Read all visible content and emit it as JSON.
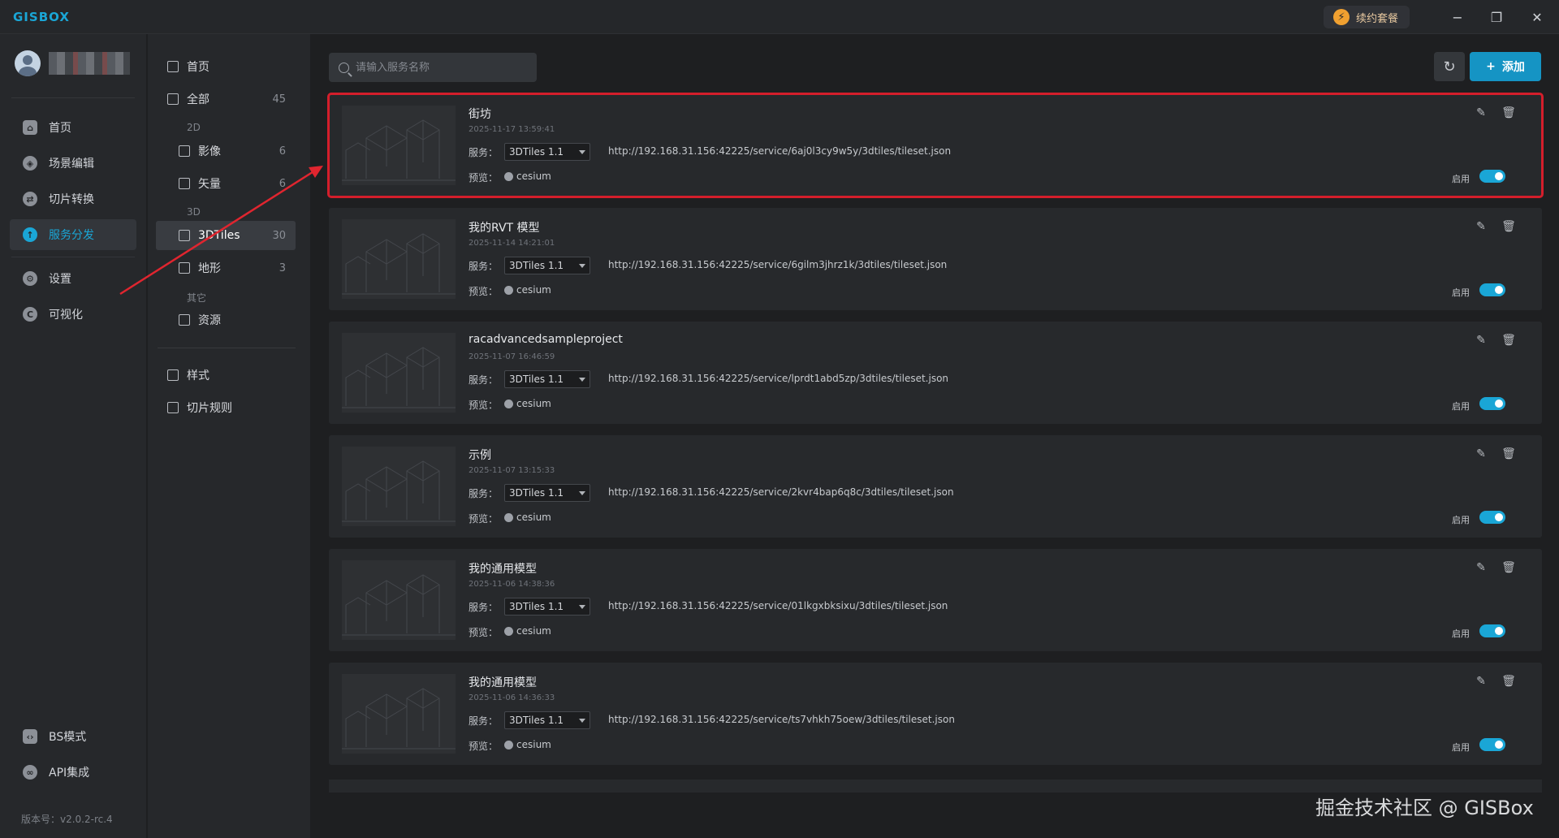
{
  "window": {
    "logo": "GISBOX",
    "renew_label": "续约套餐",
    "minimize": "−",
    "maximize": "❐",
    "close": "✕"
  },
  "sidebar": {
    "items": [
      {
        "label": "首页",
        "icon": "home-icon",
        "glyph": "⌂"
      },
      {
        "label": "场景编辑",
        "icon": "cube-icon",
        "glyph": "◈"
      },
      {
        "label": "切片转换",
        "icon": "swap-icon",
        "glyph": "⇄"
      },
      {
        "label": "服务分发",
        "icon": "upload-icon",
        "glyph": "↑"
      },
      {
        "label": "设置",
        "icon": "gear-icon",
        "glyph": "⚙"
      },
      {
        "label": "可视化",
        "icon": "chart-icon",
        "glyph": "C"
      }
    ],
    "bottom_items": [
      {
        "label": "BS模式",
        "icon": "code-icon",
        "glyph": "‹›"
      },
      {
        "label": "API集成",
        "icon": "link-icon",
        "glyph": "∞"
      }
    ],
    "version": "版本号：v2.0.2-rc.4"
  },
  "subnav": {
    "home": "首页",
    "all": {
      "label": "全部",
      "count": "45"
    },
    "cat_2d": "2D",
    "imagery": {
      "label": "影像",
      "count": "6"
    },
    "vector": {
      "label": "矢量",
      "count": "6"
    },
    "cat_3d": "3D",
    "tiles3d": {
      "label": "3DTiles",
      "count": "30"
    },
    "terrain": {
      "label": "地形",
      "count": "3"
    },
    "cat_other": "其它",
    "resource": "资源",
    "style": "样式",
    "tile_rules": "切片规则"
  },
  "toolbar": {
    "search_placeholder": "请输入服务名称",
    "add_label": "添加",
    "refresh_glyph": "↻"
  },
  "labels": {
    "service": "服务：",
    "preview": "预览：",
    "enable": "启用",
    "cesium": "cesium",
    "edit_glyph": "✎",
    "delete_glyph": "🗑"
  },
  "cards": [
    {
      "title": "街坊",
      "date": "2025-11-17 13:59:41",
      "service": "3DTiles 1.1",
      "url": "http://192.168.31.156:42225/service/6aj0l3cy9w5y/3dtiles/tileset.json",
      "enabled": true
    },
    {
      "title": "我的RVT 模型",
      "date": "2025-11-14 14:21:01",
      "service": "3DTiles 1.1",
      "url": "http://192.168.31.156:42225/service/6gilm3jhrz1k/3dtiles/tileset.json",
      "enabled": true
    },
    {
      "title": "racadvancedsampleproject",
      "date": "2025-11-07 16:46:59",
      "service": "3DTiles 1.1",
      "url": "http://192.168.31.156:42225/service/lprdt1abd5zp/3dtiles/tileset.json",
      "enabled": true
    },
    {
      "title": "示例",
      "date": "2025-11-07 13:15:33",
      "service": "3DTiles 1.1",
      "url": "http://192.168.31.156:42225/service/2kvr4bap6q8c/3dtiles/tileset.json",
      "enabled": true
    },
    {
      "title": "我的通用模型",
      "date": "2025-11-06 14:38:36",
      "service": "3DTiles 1.1",
      "url": "http://192.168.31.156:42225/service/01lkgxbksixu/3dtiles/tileset.json",
      "enabled": true
    },
    {
      "title": "我的通用模型",
      "date": "2025-11-06 14:36:33",
      "service": "3DTiles 1.1",
      "url": "http://192.168.31.156:42225/service/ts7vhkh75oew/3dtiles/tileset.json",
      "enabled": true
    }
  ],
  "watermark": "掘金技术社区 @ GISBox",
  "colors": {
    "accent": "#1aa6d6",
    "highlight": "#d41e2b",
    "add_button": "#1594c4"
  }
}
